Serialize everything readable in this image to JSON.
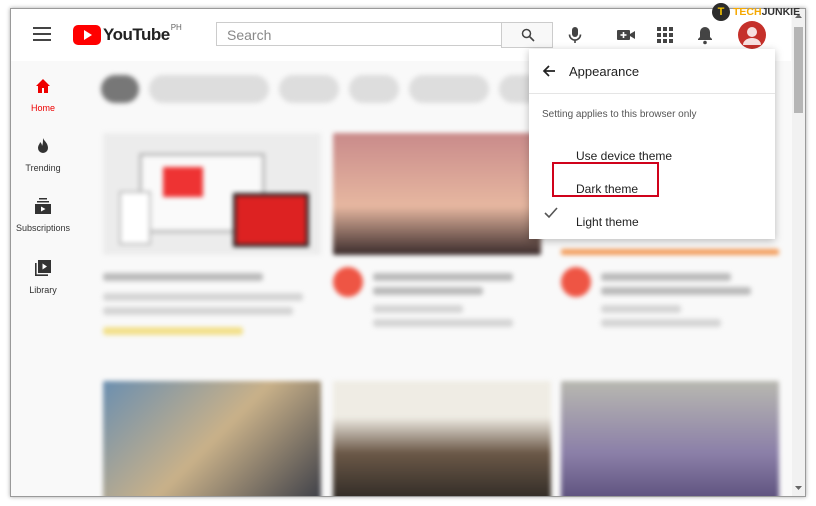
{
  "header": {
    "logo_text": "YouTube",
    "logo_country": "PH",
    "search_placeholder": "Search"
  },
  "sidebar": {
    "items": [
      {
        "label": "Home",
        "icon": "home-icon",
        "active": true
      },
      {
        "label": "Trending",
        "icon": "fire-icon"
      },
      {
        "label": "Subscriptions",
        "icon": "subscriptions-icon"
      },
      {
        "label": "Library",
        "icon": "library-icon"
      }
    ]
  },
  "appearance_menu": {
    "title": "Appearance",
    "note": "Setting applies to this browser only",
    "options": [
      {
        "label": "Use device theme",
        "selected": false
      },
      {
        "label": "Dark theme",
        "selected": false,
        "highlighted": true
      },
      {
        "label": "Light theme",
        "selected": true
      }
    ]
  },
  "watermark": {
    "badge": "T",
    "text_a": "TECH",
    "text_b": "JUNKIE"
  },
  "colors": {
    "brand_red": "#ff0000",
    "highlight_box": "#d0021b",
    "watermark_orange": "#f5a800"
  }
}
